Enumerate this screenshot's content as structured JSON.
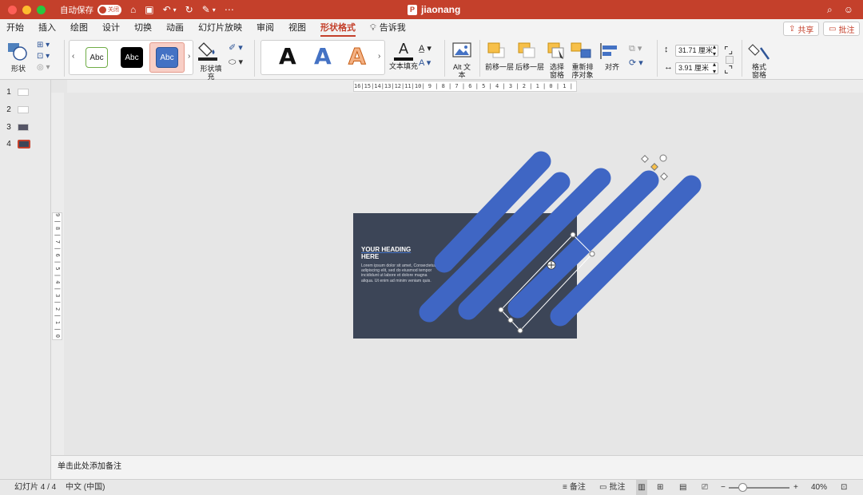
{
  "titlebar": {
    "autosave_label": "自动保存",
    "autosave_state": "关闭",
    "doc_badge": "P",
    "doc_title": "jiaonang",
    "icons": [
      "home-icon",
      "save-icon",
      "undo-icon",
      "redo-icon",
      "edit-icon",
      "more-icon",
      "search-icon",
      "person-icon"
    ]
  },
  "tabs": [
    "开始",
    "插入",
    "绘图",
    "设计",
    "切换",
    "动画",
    "幻灯片放映",
    "审阅",
    "视图",
    "形状格式",
    "告诉我"
  ],
  "active_tab": "形状格式",
  "share_label": "共享",
  "comment_label": "批注",
  "ribbon": {
    "shape_label": "形状",
    "gallery_samples": [
      "Abc",
      "Abc",
      "Abc"
    ],
    "shape_fill_label": "形状填充",
    "text_fill_label": "文本填充",
    "alt_text_label": "Alt 文本",
    "bring_forward_label": "前移一层",
    "send_backward_label": "后移一层",
    "selection_pane_label": "选择 窗格",
    "reorder_label": "重新排 序对象",
    "align_label": "对齐",
    "height_value": "31.71 厘米",
    "width_value": "3.91 厘米",
    "format_pane_label": "格式 窗格",
    "wordart_letter": "A"
  },
  "slides": [
    {
      "num": "1"
    },
    {
      "num": "2"
    },
    {
      "num": "3"
    },
    {
      "num": "4"
    }
  ],
  "ruler_top_text": "16|15|14|13|12|11|10| 9 | 8 | 7 | 6 | 5 | 4 | 3 | 2 | 1 | 0 | 1 | 2 | 3 | 4 | 5 | 6 | 7 | 8 | 9 |10|11|12|13|14|15|16",
  "ruler_left_text": "9 | 8 | 7 | 6 | 5 | 4 | 3 | 2 | 1 | 0 | 1 | 2 | 3 | 4 | 5 | 6 | 7 | 8 | 9",
  "slide_content": {
    "heading_line1": "YOUR HEADING",
    "heading_line2": "HERE",
    "body": "Lorem ipsum dolor sit amet, Consectetur adipiscing elit, sed do eiusmod tempor incididunt ut labore et dolore magna aliqua. Ut enim ad minim veniam quis.",
    "bg_color": "#3c4557",
    "shape_color": "#3f66c4"
  },
  "notes_placeholder": "单击此处添加备注",
  "statusbar": {
    "slide_counter": "幻灯片 4 / 4",
    "language": "中文 (中国)",
    "notes_label": "备注",
    "comments_label": "批注",
    "zoom_minus": "−",
    "zoom_plus": "+",
    "zoom_percent": "40%"
  }
}
